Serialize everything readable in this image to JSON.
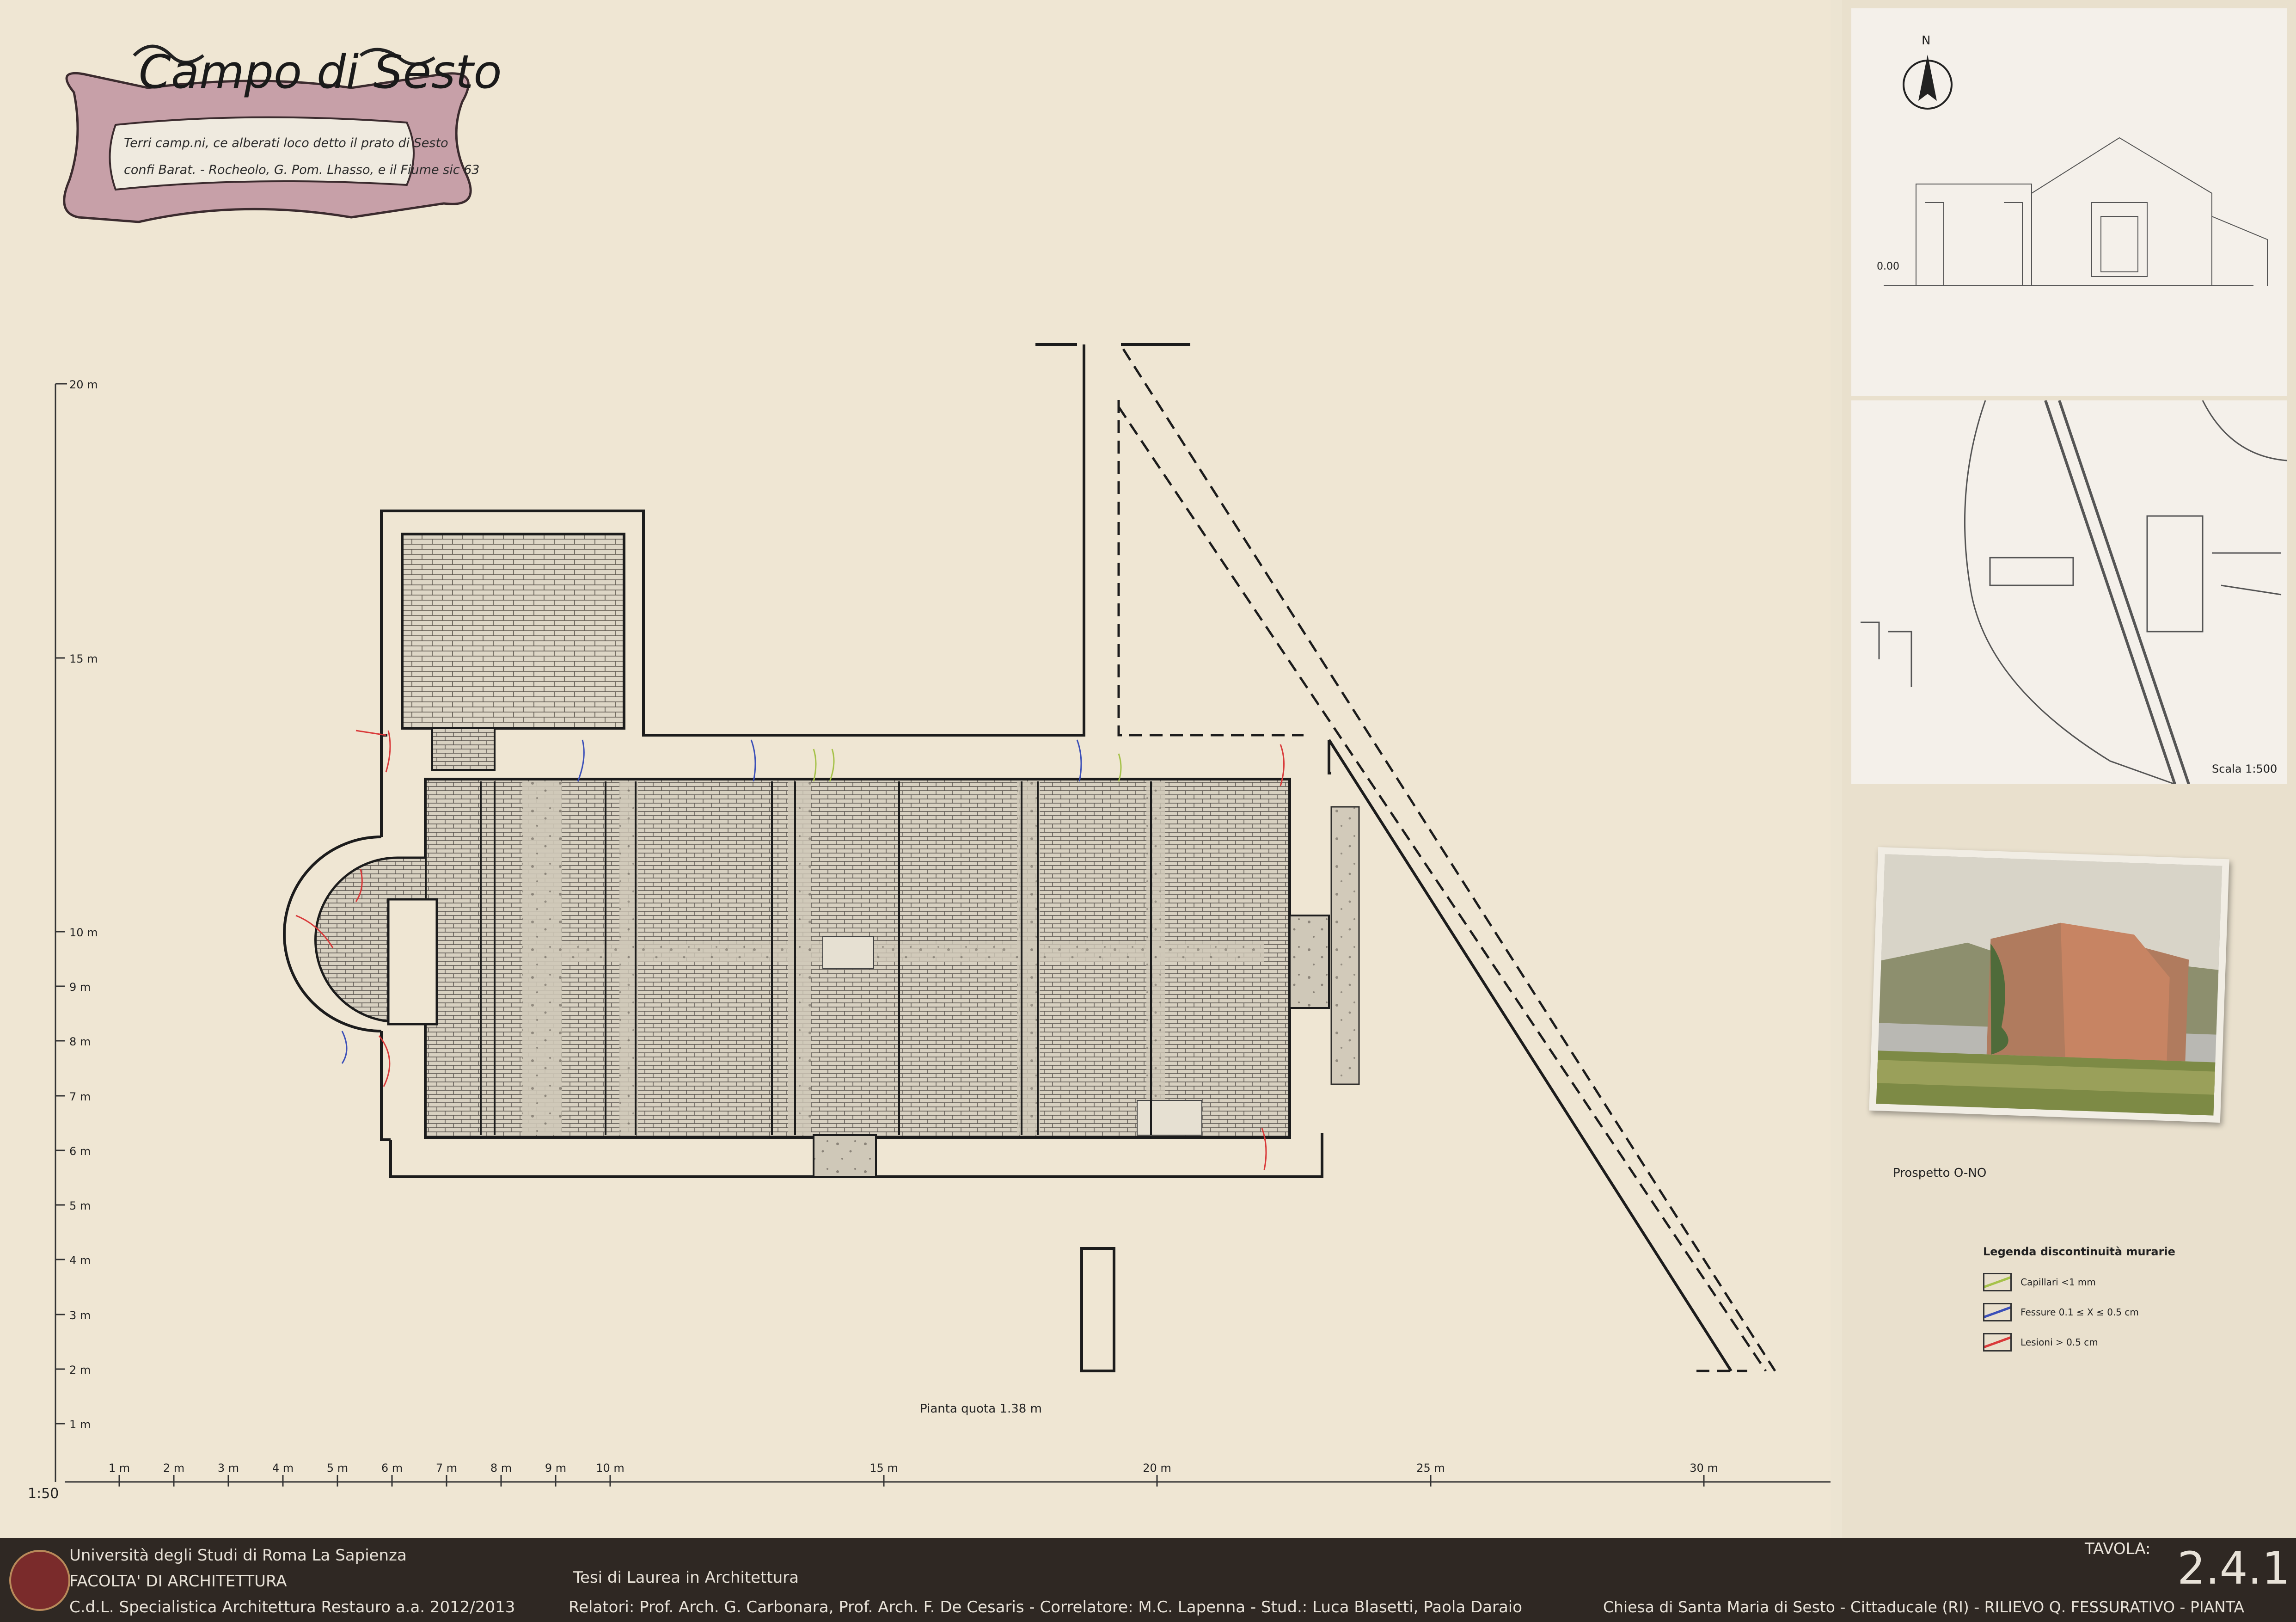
{
  "cartouche": {
    "title": "Campo di Sesto",
    "subtitle_line1": "Terri camp.ni, ce alberati loco detto il prato di Sesto",
    "subtitle_line2": "confi Barat. - Rocheolo, G. Pom. Lhasso, e il Fiume sic 63"
  },
  "scale": {
    "vertical_ticks": [
      "1 m",
      "2 m",
      "3 m",
      "4 m",
      "5 m",
      "6 m",
      "7 m",
      "8 m",
      "9 m",
      "10 m",
      "15 m",
      "20 m"
    ],
    "horizontal_ticks": [
      "1 m",
      "2 m",
      "3 m",
      "4 m",
      "5 m",
      "6 m",
      "7 m",
      "8 m",
      "9 m",
      "10 m",
      "15 m",
      "20 m",
      "25 m",
      "30 m"
    ],
    "ratio": "1:50"
  },
  "plan": {
    "caption": "Pianta quota 1.38 m"
  },
  "sidebar": {
    "north_label": "N",
    "elevation_level": "0.00",
    "site_scale": "Scala 1:500",
    "photo_caption": "Prospetto O-NO",
    "legend": {
      "title": "Legenda discontinuità murarie",
      "items": [
        {
          "label": "Capillari <1 mm",
          "color": "#a6c24a"
        },
        {
          "label": "Fessure 0.1 ≤ X ≤ 0.5 cm",
          "color": "#3b4fb8"
        },
        {
          "label": "Lesioni > 0.5 cm",
          "color": "#d93a3a"
        }
      ]
    }
  },
  "footer": {
    "university": "Università degli Studi di Roma La Sapienza",
    "faculty": "FACOLTA' DI ARCHITETTURA",
    "course": "C.d.L. Specialistica Architettura Restauro a.a. 2012/2013",
    "thesis": "Tesi di Laurea in Architettura",
    "credits": "Relatori: Prof. Arch. G. Carbonara, Prof. Arch. F. De Cesaris - Correlatore: M.C. Lapenna - Stud.: Luca Blasetti, Paola Daraio",
    "tavola_label": "TAVOLA:",
    "tavola_number": "2.4.1",
    "subject": "Chiesa di Santa Maria di Sesto - Cittaducale (RI) - RILIEVO Q. FESSURATIVO - PIANTA"
  }
}
